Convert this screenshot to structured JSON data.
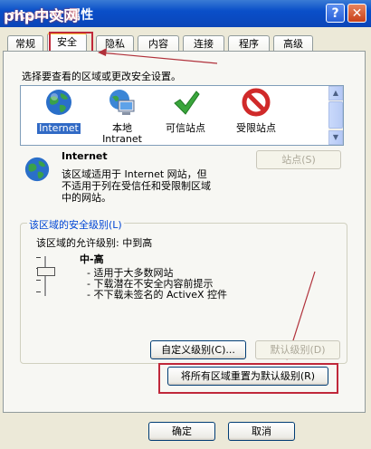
{
  "window": {
    "title_visible": "nternet 属性",
    "help": "?",
    "close": "✕",
    "logo": "php中文网"
  },
  "tabs": [
    "常规",
    "安全",
    "隐私",
    "内容",
    "连接",
    "程序",
    "高级"
  ],
  "security": {
    "instruction": "选择要查看的区域或更改安全设置。",
    "zones": [
      {
        "label": "Internet",
        "icon": "globe-icon"
      },
      {
        "label": "本地\nIntranet",
        "icon": "intranet-computer-icon"
      },
      {
        "label": "可信站点",
        "icon": "checkmark-icon"
      },
      {
        "label": "受限站点",
        "icon": "prohibited-icon"
      }
    ],
    "zone_title": "Internet",
    "zone_desc": [
      "该区域适用于 Internet 网站，但",
      "不适用于列在受信任和受限制区域",
      "中的网站。"
    ],
    "sites_button": "站点(S)",
    "group_title": "该区域的安全级别(L)",
    "allowed_level": "该区域的允许级别: 中到高",
    "level_name": "中-高",
    "level_points": [
      "- 适用于大多数网站",
      "- 下载潜在不安全内容前提示",
      "- 不下载未签名的 ActiveX 控件"
    ],
    "custom_level_button": "自定义级别(C)...",
    "default_level_button": "默认级别(D)",
    "reset_all_button": "将所有区域重置为默认级别(R)"
  },
  "footer": {
    "ok_button": "确定",
    "cancel_button": "取消"
  }
}
